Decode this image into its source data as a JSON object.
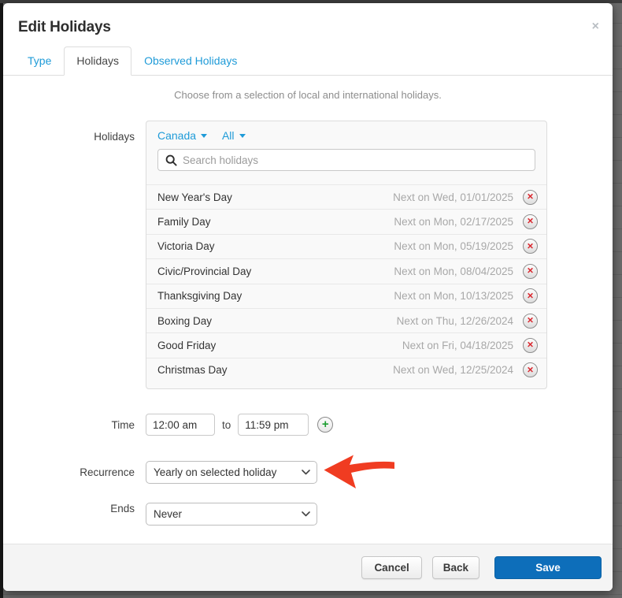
{
  "modal": {
    "title": "Edit Holidays"
  },
  "tabs": [
    {
      "label": "Type",
      "active": false
    },
    {
      "label": "Holidays",
      "active": true
    },
    {
      "label": "Observed Holidays",
      "active": false
    }
  ],
  "subtitle": "Choose from a selection of local and international holidays.",
  "holidays_section": {
    "label": "Holidays",
    "country_filter": "Canada",
    "scope_filter": "All",
    "search_placeholder": "Search holidays",
    "items": [
      {
        "name": "New Year's Day",
        "next": "Next on Wed, 01/01/2025"
      },
      {
        "name": "Family Day",
        "next": "Next on Mon, 02/17/2025"
      },
      {
        "name": "Victoria Day",
        "next": "Next on Mon, 05/19/2025"
      },
      {
        "name": "Civic/Provincial Day",
        "next": "Next on Mon, 08/04/2025"
      },
      {
        "name": "Thanksgiving Day",
        "next": "Next on Mon, 10/13/2025"
      },
      {
        "name": "Boxing Day",
        "next": "Next on Thu, 12/26/2024"
      },
      {
        "name": "Good Friday",
        "next": "Next on Fri, 04/18/2025"
      },
      {
        "name": "Christmas Day",
        "next": "Next on Wed, 12/25/2024"
      }
    ]
  },
  "time_section": {
    "label": "Time",
    "start": "12:00 am",
    "separator": "to",
    "end": "11:59 pm"
  },
  "recurrence_section": {
    "label": "Recurrence",
    "value": "Yearly on selected holiday"
  },
  "ends_section": {
    "label": "Ends",
    "value": "Never"
  },
  "footer": {
    "cancel": "Cancel",
    "back": "Back",
    "save": "Save"
  },
  "icons": {
    "close": "×",
    "delete": "✕",
    "add": "+"
  },
  "colors": {
    "link_blue": "#1f9bd8",
    "save_blue": "#0d6eba",
    "delete_red": "#d9272e",
    "plus_green": "#1d9e31",
    "arrow_red": "#f03c21"
  }
}
